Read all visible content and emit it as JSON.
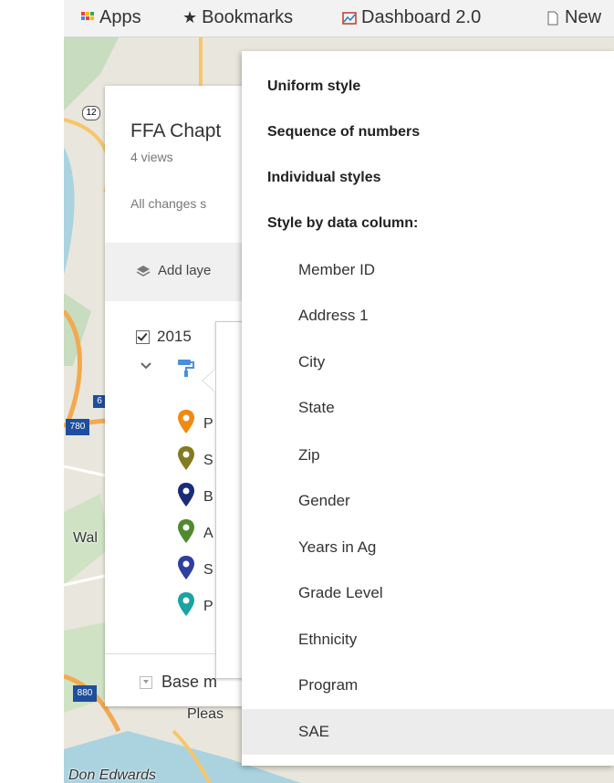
{
  "bookmarks_bar": {
    "items": [
      {
        "label": "Apps",
        "icon": "apps-grid-icon"
      },
      {
        "label": "Bookmarks",
        "icon": "star-icon"
      },
      {
        "label": "Dashboard 2.0",
        "icon": "dashboard-image-icon"
      },
      {
        "label": "New",
        "icon": "page-icon"
      }
    ]
  },
  "map": {
    "labels": [
      "Wal",
      "Pleas",
      "Don Edwards"
    ],
    "road_shields": [
      "12",
      "780",
      "880",
      "6"
    ]
  },
  "panel": {
    "title": "FFA Chapt",
    "views": "4 views",
    "changes_status": "All changes s",
    "add_layer_label": "Add laye",
    "layer_name": "2015",
    "layer_checked": true,
    "legend_letters": [
      "P",
      "S",
      "B",
      "A",
      "S",
      "P"
    ],
    "legend_colors": [
      "#ef8a12",
      "#847a1f",
      "#1a2b78",
      "#4f8b2e",
      "#2e3f9c",
      "#1aa3a3"
    ],
    "base_map_label": "Base m"
  },
  "style_menu": {
    "headers": [
      "Uniform style",
      "Sequence of numbers",
      "Individual styles",
      "Style by data column:"
    ],
    "columns": [
      "Member ID",
      "Address 1",
      "City",
      "State",
      "Zip",
      "Gender",
      "Years in Ag",
      "Grade Level",
      "Ethnicity",
      "Program",
      "SAE"
    ],
    "selected": "SAE"
  },
  "colors": {
    "accent_blue": "#4a90d9",
    "menu_selected_bg": "#ececec"
  }
}
